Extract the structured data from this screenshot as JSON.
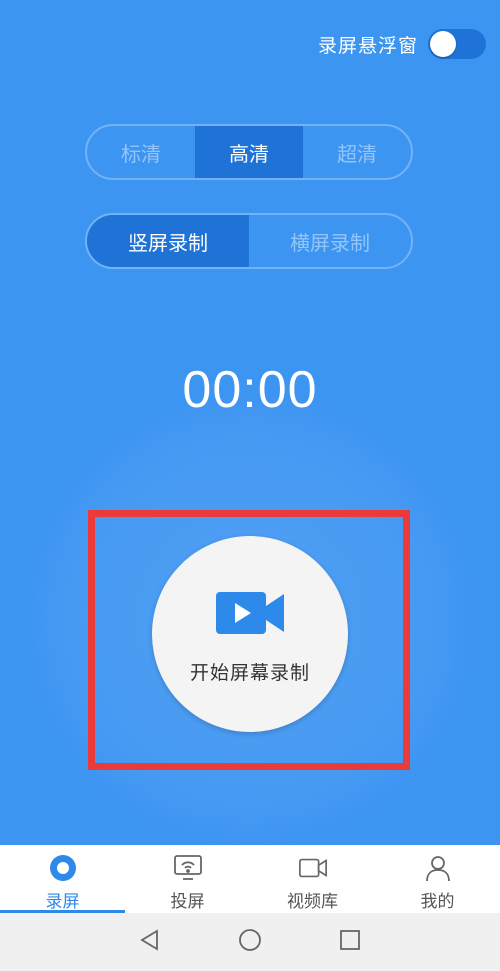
{
  "floating_window": {
    "label": "录屏悬浮窗",
    "enabled": false
  },
  "quality": {
    "options": [
      "标清",
      "高清",
      "超清"
    ],
    "selected": "高清"
  },
  "orientation": {
    "options": [
      "竖屏录制",
      "横屏录制"
    ],
    "selected": "竖屏录制"
  },
  "timer": "00:00",
  "record_button": {
    "label": "开始屏幕录制",
    "icon": "video-camera-icon"
  },
  "tabs": [
    {
      "label": "录屏",
      "icon": "record-icon",
      "active": true
    },
    {
      "label": "投屏",
      "icon": "cast-icon",
      "active": false
    },
    {
      "label": "视频库",
      "icon": "video-library-icon",
      "active": false
    },
    {
      "label": "我的",
      "icon": "user-icon",
      "active": false
    }
  ],
  "navbar": [
    "back-icon",
    "home-icon",
    "recents-icon"
  ],
  "colors": {
    "background": "#3d95f2",
    "accent": "#2d89ea",
    "segment_active": "#1f73d6",
    "highlight": "#ea3a3a"
  }
}
